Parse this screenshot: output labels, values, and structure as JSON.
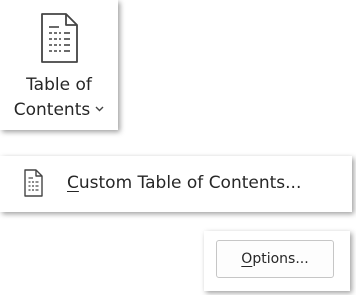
{
  "toc_button": {
    "label_line1": "Table of",
    "label_line2": "Contents",
    "icon": "document-table-of-contents-icon",
    "dropdown_icon": "chevron-down-icon"
  },
  "custom_toc_item": {
    "label_accesskey": "C",
    "label_rest": "ustom Table of Contents...",
    "icon": "document-table-of-contents-icon"
  },
  "options_button": {
    "label_accesskey": "O",
    "label_rest": "ptions..."
  }
}
